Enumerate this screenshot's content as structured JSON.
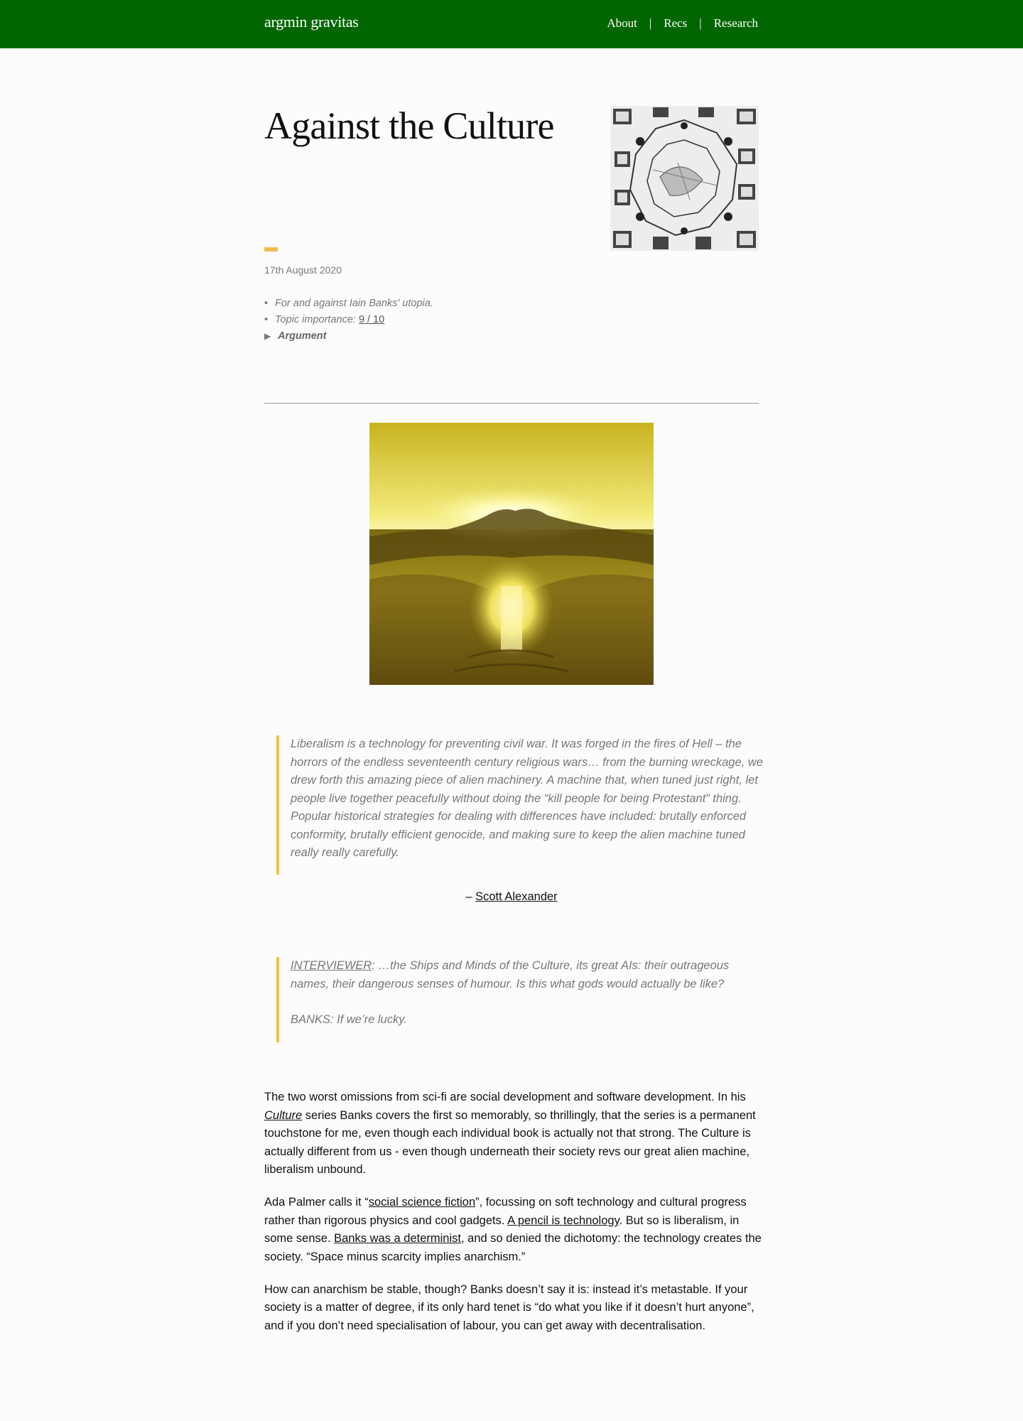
{
  "site": {
    "brand": "argmin gravitas",
    "nav": [
      {
        "label": "About"
      },
      {
        "label": "Recs"
      },
      {
        "label": "Research"
      }
    ],
    "nav_separator": "|",
    "header_color": "#016601",
    "accent_color": "#f0bd4c"
  },
  "post": {
    "title": "Against the Culture",
    "date": "17th August 2020",
    "summary": "For and against Iain Banks' utopia.",
    "importance_label": "Topic importance",
    "importance_value": "9 / 10",
    "argument_toggle": "Argument",
    "thumbnail_icon": "architectural-plan-image",
    "hero_icon": "golden-sunset-image"
  },
  "quote1": {
    "text": "Liberalism is a technology for preventing civil war. It was forged in the fires of Hell – the horrors of the endless seventeenth century religious wars… from the burning wreckage, we drew forth this amazing piece of alien machinery. A machine that, when tuned just right, let people live together peacefully without doing the “kill people for being Protestant” thing. Popular historical strategies for dealing with differences have included: brutally enforced conformity, brutally efficient genocide, and making sure to keep the alien machine tuned really really carefully.",
    "dash": "–",
    "author": "Scott Alexander"
  },
  "quote2": {
    "interviewer": "INTERVIEWER",
    "question": ": …the Ships and Minds of the Culture, its great AIs: their outrageous names, their dangerous senses of humour. Is this what gods would actually be like?",
    "answer": "BANKS: If we’re lucky."
  },
  "body": {
    "p1_a": "The two worst omissions from sci-fi are social development and software development. In his ",
    "p1_link": "Culture",
    "p1_b": " series Banks covers the first so memorably, so thrillingly, that the series is a permanent touchstone for me, even though each individual book is actually not that strong. The Culture is actually different from us - even though underneath their society revs our great alien machine, liberalism unbound.",
    "p2_a": "Ada Palmer calls it “",
    "p2_link1": "social science fiction",
    "p2_b": "”, focussing on soft technology and cultural progress rather than rigorous physics and cool gadgets. ",
    "p2_link2": "A pencil is technology",
    "p2_c": ". But so is liberalism, in some sense. ",
    "p2_link3": "Banks was a determinist",
    "p2_d": ", and so denied the dichotomy: the technology creates the society. “Space minus scarcity implies anarchism.”",
    "p3": "How can anarchism be stable, though? Banks doesn’t say it is: instead it’s metastable. If your society is a matter of degree, if its only hard tenet is “do what you like if it doesn’t hurt anyone”, and if you don’t need specialisation of labour, you can get away with decentralisation."
  }
}
